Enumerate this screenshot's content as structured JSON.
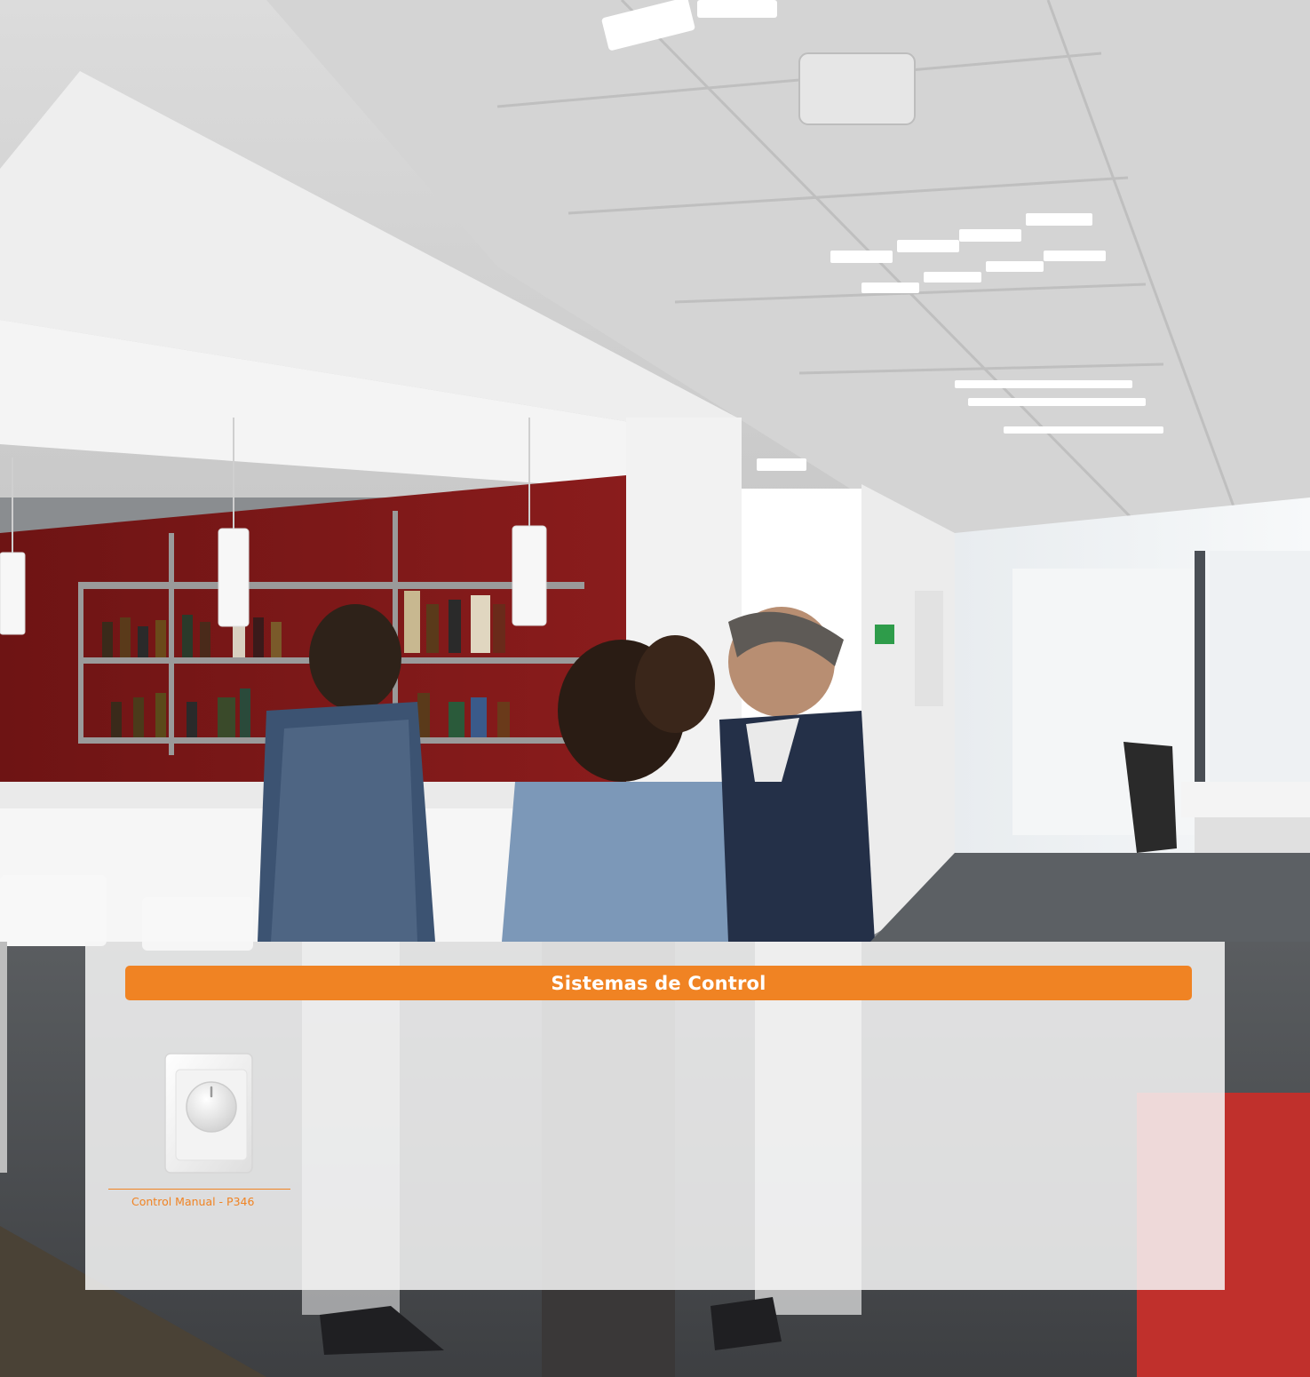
{
  "section": {
    "title": "Sistemas de Control"
  },
  "product": {
    "icon": "dimmer-switch-icon",
    "caption": "Control Manual - P346"
  },
  "colors": {
    "accent": "#f08323",
    "panel_background": "#f6f6f6",
    "wall_red": "#7a1717"
  }
}
